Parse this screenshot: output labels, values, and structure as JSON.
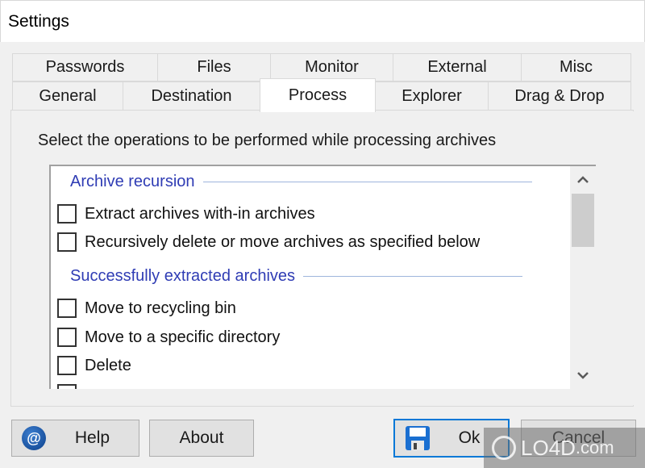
{
  "window": {
    "title": "Settings"
  },
  "tabs": {
    "row_back": [
      {
        "label": "Passwords"
      },
      {
        "label": "Files"
      },
      {
        "label": "Monitor"
      },
      {
        "label": "External"
      },
      {
        "label": "Misc"
      }
    ],
    "row_front": [
      {
        "label": "General"
      },
      {
        "label": "Destination"
      },
      {
        "label": "Process",
        "active": true
      },
      {
        "label": "Explorer"
      },
      {
        "label": "Drag & Drop"
      }
    ]
  },
  "process": {
    "intro": "Select the operations to be performed while processing archives",
    "groups": [
      {
        "header": "Archive recursion",
        "options": [
          {
            "label": "Extract archives with-in archives",
            "checked": false
          },
          {
            "label": "Recursively delete or move archives as specified below",
            "checked": false
          }
        ]
      },
      {
        "header": "Successfully extracted archives",
        "options": [
          {
            "label": "Move to recycling bin",
            "checked": false
          },
          {
            "label": "Move to a specific directory",
            "checked": false
          },
          {
            "label": "Delete",
            "checked": false
          }
        ]
      }
    ],
    "scroll_position": 0.1
  },
  "buttons": {
    "help": "Help",
    "about": "About",
    "ok": "Ok",
    "cancel": "Cancel"
  },
  "watermark": {
    "brand": "LO4D",
    "suffix": ".com"
  }
}
